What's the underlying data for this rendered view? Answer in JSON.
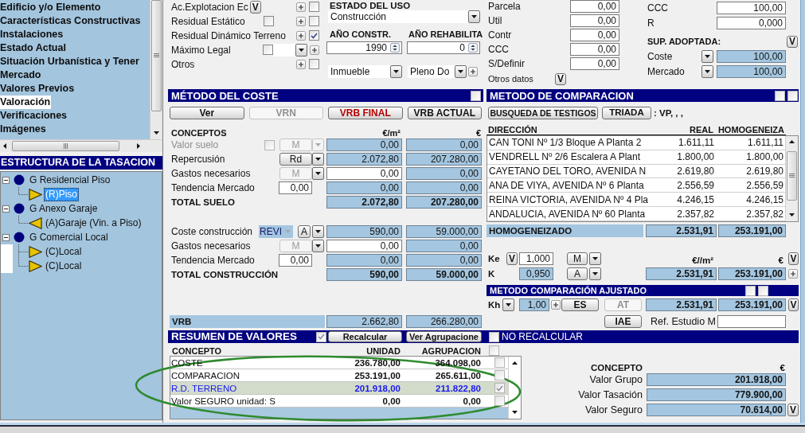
{
  "nav": {
    "items": [
      {
        "label": "Edificio y/o Elemento",
        "selected": false
      },
      {
        "label": "Características Constructivas",
        "selected": false
      },
      {
        "label": "Instalaciones",
        "selected": false
      },
      {
        "label": "Estado Actual",
        "selected": false
      },
      {
        "label": "Situación Urbanística y Tener",
        "selected": false
      },
      {
        "label": "Mercado",
        "selected": false
      },
      {
        "label": "Valores Previos",
        "selected": false
      },
      {
        "label": "Valoración",
        "selected": true
      },
      {
        "label": "Verificaciones",
        "selected": false
      },
      {
        "label": "Imágenes",
        "selected": false
      }
    ]
  },
  "tree": {
    "title": "ESTRUCTURA DE LA TASACION",
    "items": [
      {
        "label": "G Residencial Piso",
        "expanded": true,
        "children": [
          {
            "label": "(R)Piso",
            "kind": "forward",
            "selected": true
          }
        ]
      },
      {
        "label": "G Anexo Garaje",
        "expanded": true,
        "children": [
          {
            "label": "(A)Garaje (Vin. a Piso)",
            "kind": "backward",
            "selected": false
          }
        ]
      },
      {
        "label": "G Comercial Local",
        "expanded": true,
        "children": [
          {
            "label": "(C)Local",
            "kind": "forward",
            "selected": false
          },
          {
            "label": "(C)Local",
            "kind": "forward",
            "selected": false
          }
        ]
      }
    ]
  },
  "methods": [
    {
      "label": "Ac.Explotacion Ec",
      "kind": "button",
      "button": "V",
      "checked": false
    },
    {
      "label": "Residual Estático",
      "kind": "option",
      "option_checked": false,
      "checked": false
    },
    {
      "label": "Residual Dinámico Terreno",
      "kind": "plain",
      "checked": true
    },
    {
      "label": "Máximo Legal",
      "kind": "select",
      "option_checked": false
    },
    {
      "label": "Otros",
      "kind": "plain",
      "checked": false
    }
  ],
  "use_state": {
    "label": "ESTADO DEL USO",
    "value": "Construcción"
  },
  "years": [
    {
      "label": "AÑO CONSTR.",
      "value": "1990"
    },
    {
      "label": "AÑO REHABILITA",
      "value": "0"
    }
  ],
  "property_selects": [
    "Inmueble",
    "Pleno Do"
  ],
  "surfaces": [
    {
      "label": "Parcela",
      "value": "0,00"
    },
    {
      "label": "Util",
      "value": "0,00"
    },
    {
      "label": "Contr",
      "value": "0,00"
    },
    {
      "label": "CCC",
      "value": "0,00"
    },
    {
      "label": "S/Definir",
      "value": "0,00"
    }
  ],
  "other_data": {
    "label": "Otros datos",
    "button": "V"
  },
  "coefficients": [
    {
      "label": "CCC",
      "value": "100,00"
    },
    {
      "label": "R",
      "value": "0,000"
    }
  ],
  "adopted_area": {
    "label": "SUP. ADOPTADA:",
    "button": "V",
    "rows": [
      {
        "label": "Coste",
        "value": "100,00"
      },
      {
        "label": "Mercado",
        "value": "100,00"
      }
    ]
  },
  "cost_method": {
    "title": "MÉTODO DEL COSTE",
    "checked": false,
    "buttons": [
      {
        "label": "Ver",
        "kind": "normal"
      },
      {
        "label": "VRN",
        "kind": "disabled"
      },
      {
        "label": "VRB FINAL",
        "kind": "alert"
      },
      {
        "label": "VRB ACTUAL",
        "kind": "normal"
      }
    ],
    "columns": [
      "CONCEPTOS",
      "€/m²",
      "€"
    ],
    "groups": [
      {
        "rows": [
          {
            "label": "Valor suelo",
            "kind": "check_select",
            "disabled": true,
            "checked": false,
            "option": "M",
            "option_disabled": true,
            "editable": false,
            "per_m2": "0,00",
            "amount": "0,00"
          },
          {
            "label": "Repercusión",
            "kind": "select",
            "disabled": false,
            "option": "Rd",
            "option_disabled": false,
            "editable": false,
            "per_m2": "2.072,80",
            "amount": "207.280,00"
          },
          {
            "label": "Gastos necesarios",
            "kind": "select",
            "disabled": false,
            "option": "M",
            "option_disabled": true,
            "editable": true,
            "per_m2": "0,00",
            "amount": "0,00"
          },
          {
            "label": "Tendencia Mercado",
            "kind": "input",
            "disabled": false,
            "input": "0,00",
            "editable": false,
            "per_m2": "0,00",
            "amount": "0,00"
          }
        ],
        "total": {
          "label": "TOTAL SUELO",
          "per_m2": "2.072,80",
          "amount": "207.280,00"
        }
      },
      {
        "rows": [
          {
            "label": "Coste construcción",
            "kind": "combo",
            "disabled": false,
            "code": "REVI",
            "option": "A",
            "option_disabled": false,
            "editable": false,
            "per_m2": "590,00",
            "amount": "59.000,00"
          },
          {
            "label": "Gastos necesarios",
            "kind": "select",
            "disabled": false,
            "option": "M",
            "option_disabled": true,
            "editable": true,
            "per_m2": "0,00",
            "amount": "0,00"
          },
          {
            "label": "Tendencia Mercado",
            "kind": "input",
            "disabled": false,
            "input": "0,00",
            "editable": false,
            "per_m2": "0,00",
            "amount": "0,00"
          }
        ],
        "total": {
          "label": "TOTAL CONSTRUCCIÓN",
          "per_m2": "590,00",
          "amount": "59.000,00"
        }
      }
    ],
    "vrb": {
      "label": "VRB",
      "per_m2": "2.662,80",
      "amount": "266.280,00"
    }
  },
  "comparison_method": {
    "title": "METODO DE COMPARACION",
    "checks": [
      false,
      false
    ],
    "buttons": [
      "BUSQUEDA DE TESTIGOS",
      "TRIADA"
    ],
    "note": ": VP, , ,",
    "columns": [
      "DIRECCIÓN",
      "REAL",
      "HOMOGENEIZA"
    ],
    "rows": [
      {
        "address": "CAN TONI Nº 1/3 Bloque A Planta 2",
        "real": "1.611,11",
        "homogenized": "1.611,11"
      },
      {
        "address": "VENDRELL Nº 2/6 Escalera A Plant",
        "real": "1.800,00",
        "homogenized": "1.800,00"
      },
      {
        "address": "CAYETANO DEL TORO, AVENIDA N",
        "real": "2.619,80",
        "homogenized": "2.619,80"
      },
      {
        "address": "ANA DE VIYA, AVENIDA Nº 6 Planta",
        "real": "2.556,59",
        "homogenized": "2.556,59"
      },
      {
        "address": "REINA VICTORIA, AVENIDA Nº 4 Pla",
        "real": "4.246,15",
        "homogenized": "4.246,15"
      },
      {
        "address": "ANDALUCIA, AVENIDA Nº 60 Planta",
        "real": "2.357,82",
        "homogenized": "2.357,82"
      }
    ],
    "homogenized": {
      "label": "HOMOGENEIZADO",
      "per_m2": "2.531,91",
      "amount": "253.191,00"
    },
    "ke": {
      "label": "Ke",
      "button": "V",
      "value": "1,000",
      "option": "M"
    },
    "k": {
      "label": "K",
      "value": "0,950",
      "option": "A",
      "per_m2": "2.531,91",
      "amount": "253.191,00"
    },
    "units": [
      "€//m²",
      "€"
    ],
    "units_button": "V",
    "adjusted": {
      "title": "METODO COMPARACIÓN AJUSTADO",
      "checks": [
        false,
        false
      ],
      "label": "Kh",
      "value": "1,00",
      "buttons": [
        {
          "label": "ES",
          "kind": "normal"
        },
        {
          "label": "AT",
          "kind": "disabled"
        }
      ],
      "per_m2": "2.531,91",
      "amount": "253.191,00",
      "button": "V"
    },
    "iae": "IAE",
    "reference": {
      "label": "Ref. Estudio M"
    }
  },
  "summary": {
    "title": "RESUMEN DE VALORES",
    "checked": true,
    "buttons": [
      "Recalcular",
      "Ver Agrupacione"
    ],
    "no_recalc": {
      "label": "NO RECALCULAR",
      "checked": false
    },
    "columns": [
      "CONCEPTO",
      "UNIDAD",
      "AGRUPACION"
    ],
    "header_checked": false,
    "rows": [
      {
        "concept": "COSTE",
        "unit": "236.780,00",
        "group": "364.098,00",
        "checked": false,
        "selected": false
      },
      {
        "concept": "COMPARACION",
        "unit": "253.191,00",
        "group": "265.611,00",
        "checked": false,
        "selected": false
      },
      {
        "concept": "R.D. TERRENO",
        "unit": "201.918,00",
        "group": "211.822,80",
        "checked": true,
        "selected": true
      },
      {
        "concept": "Valor SEGURO unidad: S",
        "unit": "0,00",
        "group": "0,00",
        "checked": false,
        "selected": false
      }
    ],
    "totals": {
      "columns": [
        "CONCEPTO",
        "€"
      ],
      "rows": [
        {
          "label": "Valor Grupo",
          "value": "201.918,00"
        },
        {
          "label": "Valor Tasación",
          "value": "779.900,00"
        },
        {
          "label": "Valor Seguro",
          "value": "70.614,00",
          "button": "V"
        }
      ]
    }
  }
}
